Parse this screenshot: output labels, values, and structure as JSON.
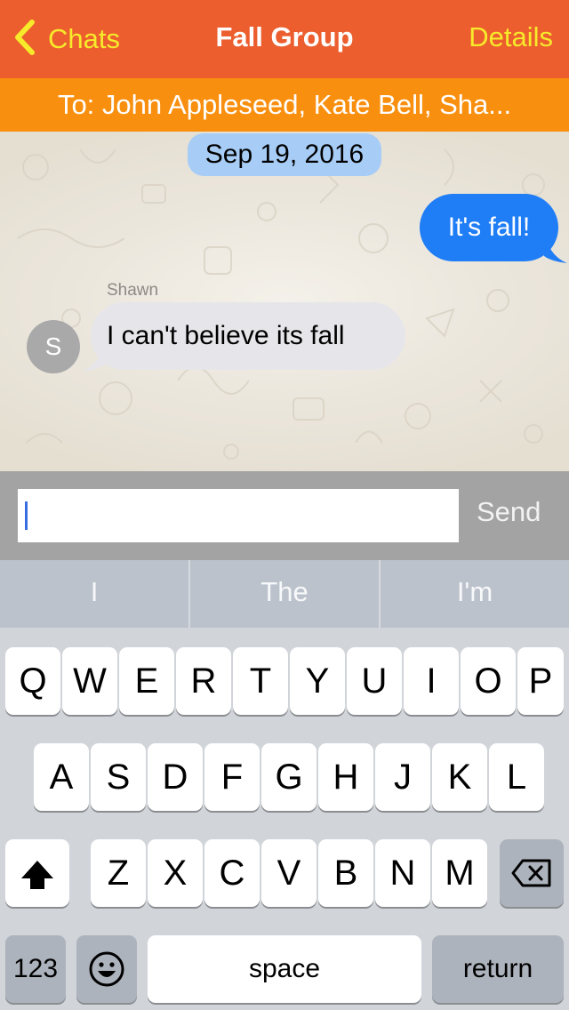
{
  "nav": {
    "back_label": "Chats",
    "title": "Fall Group",
    "details_label": "Details"
  },
  "recipients": "To: John Appleseed, Kate Bell, Sha...",
  "chat": {
    "date": "Sep 19, 2016",
    "outgoing": [
      {
        "text": "It's fall!"
      }
    ],
    "incoming": [
      {
        "sender": "Shawn",
        "avatar_initial": "S",
        "text": "I can't believe its fall"
      }
    ]
  },
  "composer": {
    "value": "",
    "send_label": "Send"
  },
  "predictive": [
    "I",
    "The",
    "I'm"
  ],
  "keyboard": {
    "row1": [
      "Q",
      "W",
      "E",
      "R",
      "T",
      "Y",
      "U",
      "I",
      "O",
      "P"
    ],
    "row2": [
      "A",
      "S",
      "D",
      "F",
      "G",
      "H",
      "J",
      "K",
      "L"
    ],
    "row3": [
      "Z",
      "X",
      "C",
      "V",
      "B",
      "N",
      "M"
    ],
    "numbers_label": "123",
    "space_label": "space",
    "return_label": "return"
  },
  "colors": {
    "nav_bg": "#ec5e2e",
    "nav_accent": "#f6ea2b",
    "recipients_bg": "#f98f0e",
    "outgoing_bubble": "#1f7df6",
    "incoming_bubble": "#e6e6ea",
    "date_pill": "#a7cdf6"
  },
  "icons": {
    "back": "chevron-left-icon",
    "shift": "shift-arrow-icon",
    "delete": "backspace-icon",
    "emoji": "smiley-icon"
  }
}
